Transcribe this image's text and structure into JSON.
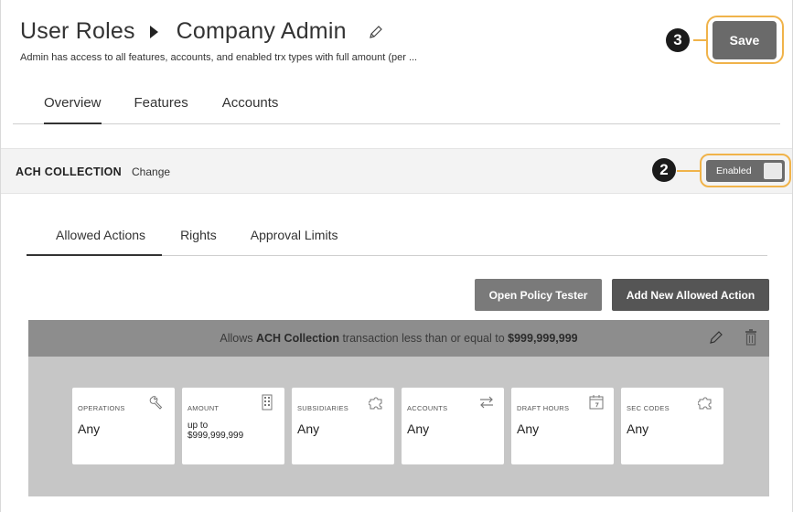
{
  "header": {
    "title_part1": "User Roles",
    "title_part2": "Company Admin",
    "subtitle": "Admin has access to all features, accounts, and enabled trx types with full amount (per ...",
    "save_label": "Save"
  },
  "callouts": {
    "save": "3",
    "toggle": "2"
  },
  "tabs": [
    {
      "label": "Overview",
      "active": true
    },
    {
      "label": "Features",
      "active": false
    },
    {
      "label": "Accounts",
      "active": false
    }
  ],
  "ach": {
    "title": "ACH COLLECTION",
    "change_label": "Change",
    "toggle_label": "Enabled"
  },
  "subtabs": [
    {
      "label": "Allowed Actions",
      "active": true
    },
    {
      "label": "Rights",
      "active": false
    },
    {
      "label": "Approval Limits",
      "active": false
    }
  ],
  "actions": {
    "policy_tester_label": "Open Policy Tester",
    "add_action_label": "Add New Allowed Action"
  },
  "rule": {
    "prefix": "Allows",
    "type": "ACH Collection",
    "middle": "transaction less than or equal to",
    "amount": "$999,999,999"
  },
  "cards": [
    {
      "label": "OPERATIONS",
      "value": "Any",
      "icon": "wrench-icon"
    },
    {
      "label": "AMOUNT",
      "value": "up to $999,999,999",
      "icon": "building-icon"
    },
    {
      "label": "SUBSIDIARIES",
      "value": "Any",
      "icon": "puzzle-icon"
    },
    {
      "label": "ACCOUNTS",
      "value": "Any",
      "icon": "transfer-arrows-icon"
    },
    {
      "label": "DRAFT HOURS",
      "value": "Any",
      "icon": "calendar-icon"
    },
    {
      "label": "SEC CODES",
      "value": "Any",
      "icon": "puzzle-icon"
    }
  ],
  "colors": {
    "accent_ring": "#f0b34a",
    "button_dark": "#555555",
    "panel_head": "#8d8d8d",
    "panel_body": "#c6c6c6"
  }
}
